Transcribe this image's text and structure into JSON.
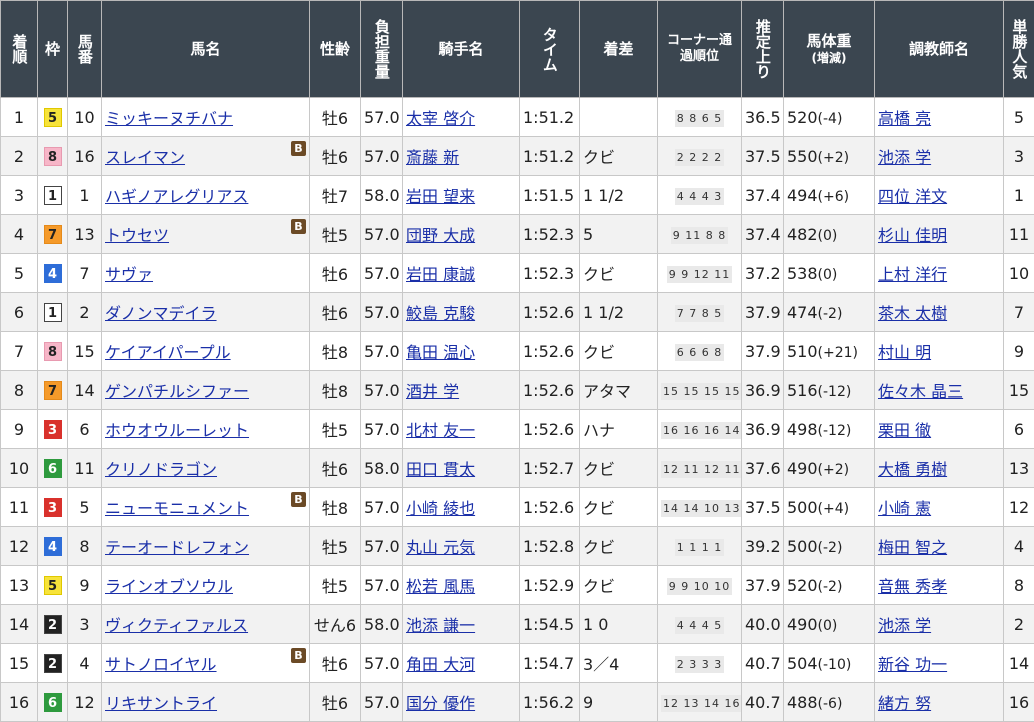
{
  "headers": {
    "rank": "着順",
    "waku": "枠",
    "num": "馬番",
    "name": "馬名",
    "sexage": "性齢",
    "weight": "負担重量",
    "jockey": "騎手名",
    "time": "タイム",
    "margin": "着差",
    "corner": "コーナー通過順位",
    "last3f": "推定上り",
    "bodyweight": "馬体重",
    "bodyweight_sub": "(増減)",
    "trainer": "調教師名",
    "popularity": "単勝人気"
  },
  "blinker_label": "B",
  "rows": [
    {
      "rank": "1",
      "waku": "5",
      "num": "10",
      "name": "ミッキーヌチバナ",
      "blinker": false,
      "sexage": "牡6",
      "weight": "57.0",
      "jockey": "太宰 啓介",
      "time": "1:51.2",
      "margin": "",
      "corner": "8 8 6 5",
      "last3f": "36.5",
      "bw": "520",
      "bwd": "(-4)",
      "trainer": "高橋 亮",
      "pop": "5"
    },
    {
      "rank": "2",
      "waku": "8",
      "num": "16",
      "name": "スレイマン",
      "blinker": true,
      "sexage": "牡6",
      "weight": "57.0",
      "jockey": "斎藤 新",
      "time": "1:51.2",
      "margin": "クビ",
      "corner": "2 2 2 2",
      "last3f": "37.5",
      "bw": "550",
      "bwd": "(+2)",
      "trainer": "池添 学",
      "pop": "3"
    },
    {
      "rank": "3",
      "waku": "1",
      "num": "1",
      "name": "ハギノアレグリアス",
      "blinker": false,
      "sexage": "牡7",
      "weight": "58.0",
      "jockey": "岩田 望来",
      "time": "1:51.5",
      "margin": "1 1/2",
      "corner": "4 4 4 3",
      "last3f": "37.4",
      "bw": "494",
      "bwd": "(+6)",
      "trainer": "四位 洋文",
      "pop": "1"
    },
    {
      "rank": "4",
      "waku": "7",
      "num": "13",
      "name": "トウセツ",
      "blinker": true,
      "sexage": "牡5",
      "weight": "57.0",
      "jockey": "団野 大成",
      "time": "1:52.3",
      "margin": "5",
      "corner": "9 11 8 8",
      "last3f": "37.4",
      "bw": "482",
      "bwd": "(0)",
      "trainer": "杉山 佳明",
      "pop": "11"
    },
    {
      "rank": "5",
      "waku": "4",
      "num": "7",
      "name": "サヴァ",
      "blinker": false,
      "sexage": "牡6",
      "weight": "57.0",
      "jockey": "岩田 康誠",
      "time": "1:52.3",
      "margin": "クビ",
      "corner": "9 9 12 11",
      "last3f": "37.2",
      "bw": "538",
      "bwd": "(0)",
      "trainer": "上村 洋行",
      "pop": "10"
    },
    {
      "rank": "6",
      "waku": "1",
      "num": "2",
      "name": "ダノンマデイラ",
      "blinker": false,
      "sexage": "牡6",
      "weight": "57.0",
      "jockey": "鮫島 克駿",
      "time": "1:52.6",
      "margin": "1 1/2",
      "corner": "7 7 8 5",
      "last3f": "37.9",
      "bw": "474",
      "bwd": "(-2)",
      "trainer": "茶木 太樹",
      "pop": "7"
    },
    {
      "rank": "7",
      "waku": "8",
      "num": "15",
      "name": "ケイアイパープル",
      "blinker": false,
      "sexage": "牡8",
      "weight": "57.0",
      "jockey": "亀田 温心",
      "time": "1:52.6",
      "margin": "クビ",
      "corner": "6 6 6 8",
      "last3f": "37.9",
      "bw": "510",
      "bwd": "(+21)",
      "trainer": "村山 明",
      "pop": "9"
    },
    {
      "rank": "8",
      "waku": "7",
      "num": "14",
      "name": "ゲンパチルシファー",
      "blinker": false,
      "sexage": "牡8",
      "weight": "57.0",
      "jockey": "酒井 学",
      "time": "1:52.6",
      "margin": "アタマ",
      "corner": "15 15 15 15",
      "last3f": "36.9",
      "bw": "516",
      "bwd": "(-12)",
      "trainer": "佐々木 晶三",
      "pop": "15"
    },
    {
      "rank": "9",
      "waku": "3",
      "num": "6",
      "name": "ホウオウルーレット",
      "blinker": false,
      "sexage": "牡5",
      "weight": "57.0",
      "jockey": "北村 友一",
      "time": "1:52.6",
      "margin": "ハナ",
      "corner": "16 16 16 14",
      "last3f": "36.9",
      "bw": "498",
      "bwd": "(-12)",
      "trainer": "栗田 徹",
      "pop": "6"
    },
    {
      "rank": "10",
      "waku": "6",
      "num": "11",
      "name": "クリノドラゴン",
      "blinker": false,
      "sexage": "牡6",
      "weight": "58.0",
      "jockey": "田口 貫太",
      "time": "1:52.7",
      "margin": "クビ",
      "corner": "12 11 12 11",
      "last3f": "37.6",
      "bw": "490",
      "bwd": "(+2)",
      "trainer": "大橋 勇樹",
      "pop": "13"
    },
    {
      "rank": "11",
      "waku": "3",
      "num": "5",
      "name": "ニューモニュメント",
      "blinker": true,
      "sexage": "牡8",
      "weight": "57.0",
      "jockey": "小崎 綾也",
      "time": "1:52.6",
      "margin": "クビ",
      "corner": "14 14 10 13",
      "last3f": "37.5",
      "bw": "500",
      "bwd": "(+4)",
      "trainer": "小崎 憲",
      "pop": "12"
    },
    {
      "rank": "12",
      "waku": "4",
      "num": "8",
      "name": "テーオードレフォン",
      "blinker": false,
      "sexage": "牡5",
      "weight": "57.0",
      "jockey": "丸山 元気",
      "time": "1:52.8",
      "margin": "クビ",
      "corner": "1 1 1 1",
      "last3f": "39.2",
      "bw": "500",
      "bwd": "(-2)",
      "trainer": "梅田 智之",
      "pop": "4"
    },
    {
      "rank": "13",
      "waku": "5",
      "num": "9",
      "name": "ラインオブソウル",
      "blinker": false,
      "sexage": "牡5",
      "weight": "57.0",
      "jockey": "松若 風馬",
      "time": "1:52.9",
      "margin": "クビ",
      "corner": "9 9 10 10",
      "last3f": "37.9",
      "bw": "520",
      "bwd": "(-2)",
      "trainer": "音無 秀孝",
      "pop": "8"
    },
    {
      "rank": "14",
      "waku": "2",
      "num": "3",
      "name": "ヴィクティファルス",
      "blinker": false,
      "sexage": "せん6",
      "weight": "58.0",
      "jockey": "池添 謙一",
      "time": "1:54.5",
      "margin": "1 0",
      "corner": "4 4 4 5",
      "last3f": "40.0",
      "bw": "490",
      "bwd": "(0)",
      "trainer": "池添 学",
      "pop": "2"
    },
    {
      "rank": "15",
      "waku": "2",
      "num": "4",
      "name": "サトノロイヤル",
      "blinker": true,
      "sexage": "牡6",
      "weight": "57.0",
      "jockey": "角田 大河",
      "time": "1:54.7",
      "margin": "3／4",
      "corner": "2 3 3 3",
      "last3f": "40.7",
      "bw": "504",
      "bwd": "(-10)",
      "trainer": "新谷 功一",
      "pop": "14"
    },
    {
      "rank": "16",
      "waku": "6",
      "num": "12",
      "name": "リキサントライ",
      "blinker": false,
      "sexage": "牡6",
      "weight": "57.0",
      "jockey": "国分 優作",
      "time": "1:56.2",
      "margin": "9",
      "corner": "12 13 14 16",
      "last3f": "40.7",
      "bw": "488",
      "bwd": "(-6)",
      "trainer": "緒方 努",
      "pop": "16"
    }
  ]
}
